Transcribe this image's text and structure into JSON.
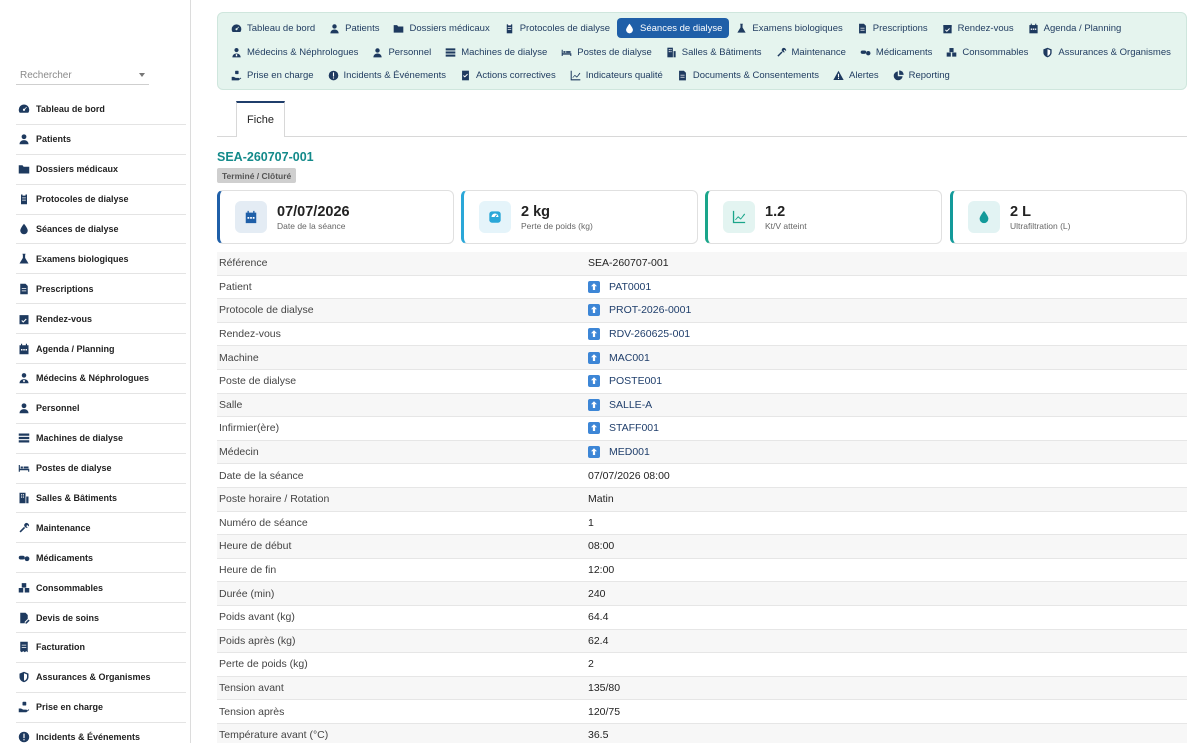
{
  "colors": {
    "accent": "#1f5fa8",
    "title": "#138a8a",
    "nav_bg": "#e5f4ee",
    "link_icon": "#3d86d6"
  },
  "search": {
    "placeholder": "Rechercher"
  },
  "sidebar": {
    "items": [
      {
        "label": "Tableau de bord",
        "icon": "dashboard-icon"
      },
      {
        "label": "Patients",
        "icon": "user-icon"
      },
      {
        "label": "Dossiers médicaux",
        "icon": "folder-icon"
      },
      {
        "label": "Protocoles de dialyse",
        "icon": "clipboard-icon"
      },
      {
        "label": "Séances de dialyse",
        "icon": "droplet-icon"
      },
      {
        "label": "Examens biologiques",
        "icon": "flask-icon"
      },
      {
        "label": "Prescriptions",
        "icon": "file-icon"
      },
      {
        "label": "Rendez-vous",
        "icon": "calendar-check-icon"
      },
      {
        "label": "Agenda / Planning",
        "icon": "calendar-icon"
      },
      {
        "label": "Médecins & Néphrologues",
        "icon": "doctor-icon"
      },
      {
        "label": "Personnel",
        "icon": "user-icon"
      },
      {
        "label": "Machines de dialyse",
        "icon": "server-icon"
      },
      {
        "label": "Postes de dialyse",
        "icon": "bed-icon"
      },
      {
        "label": "Salles & Bâtiments",
        "icon": "building-icon"
      },
      {
        "label": "Maintenance",
        "icon": "tools-icon"
      },
      {
        "label": "Médicaments",
        "icon": "pills-icon"
      },
      {
        "label": "Consommables",
        "icon": "boxes-icon"
      },
      {
        "label": "Devis de soins",
        "icon": "file-pen-icon"
      },
      {
        "label": "Facturation",
        "icon": "invoice-icon"
      },
      {
        "label": "Assurances & Organismes",
        "icon": "shield-icon"
      },
      {
        "label": "Prise en charge",
        "icon": "hand-holding-icon"
      },
      {
        "label": "Incidents & Événements",
        "icon": "alert-circle-icon"
      }
    ]
  },
  "topnav": {
    "row1": [
      {
        "label": "Tableau de bord",
        "icon": "dashboard-icon"
      },
      {
        "label": "Patients",
        "icon": "user-icon"
      },
      {
        "label": "Dossiers médicaux",
        "icon": "folder-icon"
      },
      {
        "label": "Protocoles de dialyse",
        "icon": "clipboard-icon"
      },
      {
        "label": "Séances de dialyse",
        "icon": "droplet-icon",
        "active": true
      },
      {
        "label": "Examens biologiques",
        "icon": "flask-icon"
      },
      {
        "label": "Prescriptions",
        "icon": "file-icon"
      },
      {
        "label": "Rendez-vous",
        "icon": "calendar-check-icon"
      },
      {
        "label": "Agenda / Planning",
        "icon": "calendar-icon"
      }
    ],
    "row2": [
      {
        "label": "Médecins & Néphrologues",
        "icon": "doctor-icon"
      },
      {
        "label": "Personnel",
        "icon": "user-icon"
      },
      {
        "label": "Machines de dialyse",
        "icon": "server-icon"
      },
      {
        "label": "Postes de dialyse",
        "icon": "bed-icon"
      },
      {
        "label": "Salles & Bâtiments",
        "icon": "building-icon"
      },
      {
        "label": "Maintenance",
        "icon": "tools-icon"
      },
      {
        "label": "Médicaments",
        "icon": "pills-icon"
      },
      {
        "label": "Consommables",
        "icon": "boxes-icon"
      },
      {
        "label": "Assurances & Organismes",
        "icon": "shield-icon"
      }
    ],
    "row3": [
      {
        "label": "Prise en charge",
        "icon": "hand-holding-icon"
      },
      {
        "label": "Incidents & Événements",
        "icon": "alert-circle-icon"
      },
      {
        "label": "Actions correctives",
        "icon": "checklist-icon"
      },
      {
        "label": "Indicateurs qualité",
        "icon": "chart-line-icon"
      },
      {
        "label": "Documents & Consentements",
        "icon": "file-icon"
      },
      {
        "label": "Alertes",
        "icon": "warning-icon"
      },
      {
        "label": "Reporting",
        "icon": "pie-chart-icon"
      }
    ]
  },
  "tabs": [
    {
      "label": "Fiche"
    }
  ],
  "record": {
    "title": "SEA-260707-001",
    "status": "Terminé / Clôturé"
  },
  "cards": [
    {
      "value": "07/07/2026",
      "label": "Date de la séance",
      "icon": "calendar-icon",
      "color": "#1f5fa8"
    },
    {
      "value": "2 kg",
      "label": "Perte de poids (kg)",
      "icon": "scale-icon",
      "color": "#2aa7d8"
    },
    {
      "value": "1.2",
      "label": "Kt/V atteint",
      "icon": "chart-line-icon",
      "color": "#1aa58a"
    },
    {
      "value": "2 L",
      "label": "Ultrafiltration (L)",
      "icon": "droplet-icon",
      "color": "#139a9a"
    }
  ],
  "details": [
    {
      "key": "Référence",
      "value": "SEA-260707-001",
      "link": false
    },
    {
      "key": "Patient",
      "value": "PAT0001",
      "link": true
    },
    {
      "key": "Protocole de dialyse",
      "value": "PROT-2026-0001",
      "link": true
    },
    {
      "key": "Rendez-vous",
      "value": "RDV-260625-001",
      "link": true
    },
    {
      "key": "Machine",
      "value": "MAC001",
      "link": true
    },
    {
      "key": "Poste de dialyse",
      "value": "POSTE001",
      "link": true
    },
    {
      "key": "Salle",
      "value": "SALLE-A",
      "link": true
    },
    {
      "key": "Infirmier(ère)",
      "value": "STAFF001",
      "link": true
    },
    {
      "key": "Médecin",
      "value": "MED001",
      "link": true
    },
    {
      "key": "Date de la séance",
      "value": "07/07/2026 08:00",
      "link": false
    },
    {
      "key": "Poste horaire / Rotation",
      "value": "Matin",
      "link": false
    },
    {
      "key": "Numéro de séance",
      "value": "1",
      "link": false
    },
    {
      "key": "Heure de début",
      "value": "08:00",
      "link": false
    },
    {
      "key": "Heure de fin",
      "value": "12:00",
      "link": false
    },
    {
      "key": "Durée (min)",
      "value": "240",
      "link": false
    },
    {
      "key": "Poids avant (kg)",
      "value": "64.4",
      "link": false
    },
    {
      "key": "Poids après (kg)",
      "value": "62.4",
      "link": false
    },
    {
      "key": "Perte de poids (kg)",
      "value": "2",
      "link": false
    },
    {
      "key": "Tension avant",
      "value": "135/80",
      "link": false
    },
    {
      "key": "Tension après",
      "value": "120/75",
      "link": false
    },
    {
      "key": "Température avant (°C)",
      "value": "36.5",
      "link": false
    }
  ]
}
